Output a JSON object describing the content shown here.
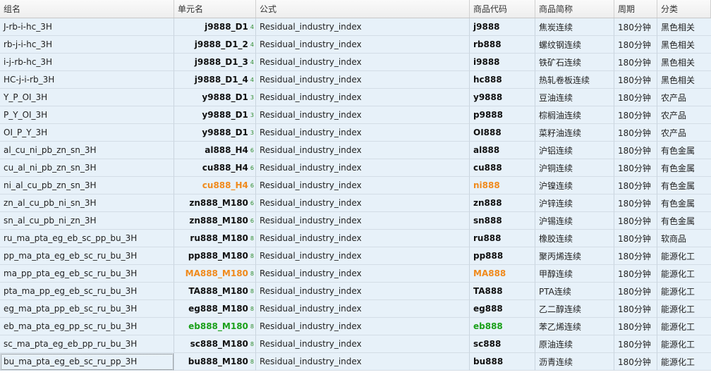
{
  "headers": {
    "group": "组名",
    "unit": "单元名",
    "formula": "公式",
    "code": "商品代码",
    "name": "商品简称",
    "period": "周期",
    "category": "分类"
  },
  "rows": [
    {
      "group": "J-rb-i-hc_3H",
      "unit": "j9888_D1",
      "suffix": "4",
      "formula": "Residual_industry_index",
      "code": "j9888",
      "name": "焦炭连续",
      "period": "180分钟",
      "category": "黑色相关",
      "highlight": "none"
    },
    {
      "group": "rb-j-i-hc_3H",
      "unit": "j9888_D1_2",
      "suffix": "4",
      "formula": "Residual_industry_index",
      "code": "rb888",
      "name": "螺纹钢连续",
      "period": "180分钟",
      "category": "黑色相关",
      "highlight": "none"
    },
    {
      "group": "i-j-rb-hc_3H",
      "unit": "j9888_D1_3",
      "suffix": "4",
      "formula": "Residual_industry_index",
      "code": "i9888",
      "name": "铁矿石连续",
      "period": "180分钟",
      "category": "黑色相关",
      "highlight": "none"
    },
    {
      "group": "HC-j-i-rb_3H",
      "unit": "j9888_D1_4",
      "suffix": "4",
      "formula": "Residual_industry_index",
      "code": "hc888",
      "name": "热轧卷板连续",
      "period": "180分钟",
      "category": "黑色相关",
      "highlight": "none"
    },
    {
      "group": "Y_P_OI_3H",
      "unit": "y9888_D1",
      "suffix": "3",
      "formula": "Residual_industry_index",
      "code": "y9888",
      "name": "豆油连续",
      "period": "180分钟",
      "category": "农产品",
      "highlight": "none"
    },
    {
      "group": "P_Y_OI_3H",
      "unit": "y9888_D1",
      "suffix": "3",
      "formula": "Residual_industry_index",
      "code": "p9888",
      "name": "棕榈油连续",
      "period": "180分钟",
      "category": "农产品",
      "highlight": "none"
    },
    {
      "group": "OI_P_Y_3H",
      "unit": "y9888_D1",
      "suffix": "3",
      "formula": "Residual_industry_index",
      "code": "OI888",
      "name": "菜籽油连续",
      "period": "180分钟",
      "category": "农产品",
      "highlight": "none"
    },
    {
      "group": "al_cu_ni_pb_zn_sn_3H",
      "unit": "al888_H4",
      "suffix": "6",
      "formula": "Residual_industry_index",
      "code": "al888",
      "name": "沪铝连续",
      "period": "180分钟",
      "category": "有色金属",
      "highlight": "none"
    },
    {
      "group": "cu_al_ni_pb_zn_sn_3H",
      "unit": "cu888_H4",
      "suffix": "6",
      "formula": "Residual_industry_index",
      "code": "cu888",
      "name": "沪铜连续",
      "period": "180分钟",
      "category": "有色金属",
      "highlight": "none"
    },
    {
      "group": "ni_al_cu_pb_zn_sn_3H",
      "unit": "cu888_H4",
      "suffix": "6",
      "formula": "Residual_industry_index",
      "code": "ni888",
      "name": "沪镍连续",
      "period": "180分钟",
      "category": "有色金属",
      "highlight": "orange"
    },
    {
      "group": "zn_al_cu_pb_ni_sn_3H",
      "unit": "zn888_M180",
      "suffix": "6",
      "formula": "Residual_industry_index",
      "code": "zn888",
      "name": "沪锌连续",
      "period": "180分钟",
      "category": "有色金属",
      "highlight": "none"
    },
    {
      "group": "sn_al_cu_pb_ni_zn_3H",
      "unit": "zn888_M180",
      "suffix": "6",
      "formula": "Residual_industry_index",
      "code": "sn888",
      "name": "沪锡连续",
      "period": "180分钟",
      "category": "有色金属",
      "highlight": "none"
    },
    {
      "group": "ru_ma_pta_eg_eb_sc_pp_bu_3H",
      "unit": "ru888_M180",
      "suffix": "8",
      "formula": "Residual_industry_index",
      "code": "ru888",
      "name": "橡胶连续",
      "period": "180分钟",
      "category": "软商品",
      "highlight": "none"
    },
    {
      "group": "pp_ma_pta_eg_eb_sc_ru_bu_3H",
      "unit": "pp888_M180",
      "suffix": "8",
      "formula": "Residual_industry_index",
      "code": "pp888",
      "name": "聚丙烯连续",
      "period": "180分钟",
      "category": "能源化工",
      "highlight": "none"
    },
    {
      "group": "ma_pp_pta_eg_eb_sc_ru_bu_3H",
      "unit": "MA888_M180",
      "suffix": "8",
      "formula": "Residual_industry_index",
      "code": "MA888",
      "name": "甲醇连续",
      "period": "180分钟",
      "category": "能源化工",
      "highlight": "orange"
    },
    {
      "group": "pta_ma_pp_eg_eb_sc_ru_bu_3H",
      "unit": "TA888_M180",
      "suffix": "8",
      "formula": "Residual_industry_index",
      "code": "TA888",
      "name": "PTA连续",
      "period": "180分钟",
      "category": "能源化工",
      "highlight": "none"
    },
    {
      "group": "eg_ma_pta_pp_eb_sc_ru_bu_3H",
      "unit": "eg888_M180",
      "suffix": "8",
      "formula": "Residual_industry_index",
      "code": "eg888",
      "name": "乙二醇连续",
      "period": "180分钟",
      "category": "能源化工",
      "highlight": "none"
    },
    {
      "group": "eb_ma_pta_eg_pp_sc_ru_bu_3H",
      "unit": "eb888_M180",
      "suffix": "8",
      "formula": "Residual_industry_index",
      "code": "eb888",
      "name": "苯乙烯连续",
      "period": "180分钟",
      "category": "能源化工",
      "highlight": "green"
    },
    {
      "group": "sc_ma_pta_eg_eb_pp_ru_bu_3H",
      "unit": "sc888_M180",
      "suffix": "8",
      "formula": "Residual_industry_index",
      "code": "sc888",
      "name": "原油连续",
      "period": "180分钟",
      "category": "能源化工",
      "highlight": "none"
    },
    {
      "group": "bu_ma_pta_eg_eb_sc_ru_pp_3H",
      "unit": "bu888_M180",
      "suffix": "8",
      "formula": "Residual_industry_index",
      "code": "bu888",
      "name": "沥青连续",
      "period": "180分钟",
      "category": "能源化工",
      "highlight": "none",
      "focused": true
    }
  ]
}
